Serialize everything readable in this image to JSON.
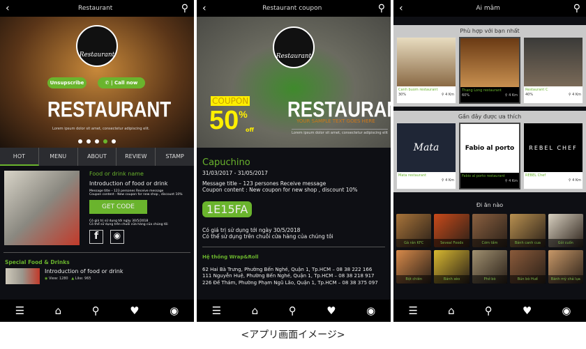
{
  "caption": "<アプリ画面イメージ>",
  "accent": "#6ab42d",
  "screen1": {
    "title": "Restaurant",
    "logo_text": "Restaurant",
    "unsubscribe": "Unsupscribe",
    "call": "Call now",
    "hero_title": "RESTAURANT",
    "hero_sub": "Lorem ipsum dolor sit amet, consectetur adipiscing elit.",
    "slides": 5,
    "active_slide": 4,
    "tabs": [
      "HOT",
      "MENU",
      "ABOUT",
      "REVIEW",
      "STAMP"
    ],
    "item": {
      "name": "Food or drink name",
      "intro": "Introduction of food or drink",
      "msg1": "Message title – 123 persones Receive message",
      "msg2": "Coupon content : New coupon for new shop , discount 10%",
      "button": "GET CODE",
      "valid1": "Có giá trị sử dụng tới ngày 30/5/2018",
      "valid2": "Có thể sử dụng trên chuỗi cửa hàng của chúng tôi"
    },
    "special": {
      "title": "Special Food & Drinks",
      "intro": "Introduction of food or drink",
      "views": "View: 1280",
      "likes": "Like: 965"
    }
  },
  "screen2": {
    "title": "Restaurant coupon",
    "logo_text": "Restaurant",
    "coupon": "COUPON",
    "percent": "50",
    "pct_sign": "%",
    "off": "off",
    "hero_title": "RESTAURANT",
    "sample": "YOUR SAMPLE TEXT GOES HERE",
    "hero_sub": "Lorem ipsum dolor sit amet, consectetur adipiscing elit",
    "name": "Capuchino",
    "dates": "31/03/2017 - 31/05/2017",
    "msg1": "Message title – 123 persones Receive message",
    "msg2": "Coupon content : New coupon for new shop , discount 10%",
    "code": "1E15FA",
    "valid1": "Có giá trị sử dụng tới ngày 30/5/2018",
    "valid2": "Có thể sử dụng trên chuỗi cửa hàng của chúng tôi",
    "chain": "Hệ thống Wrap&Roll",
    "addresses": [
      "62 Hai Bà Trưng, Phường Bến Nghé, Quận 1, Tp.HCM – 08 38 222 166",
      "111 Nguyễn Huệ, Phường Bến Nghé, Quận 1, Tp.HCM – 08 38 218 917",
      "226 Đề Thám, Phường Phạm Ngũ Lão, Quận 1, Tp.HCM – 08 38 375 097"
    ]
  },
  "screen3": {
    "title": "Ai mâm",
    "best": {
      "title": "Phù hợp với bạn nhất",
      "cards": [
        {
          "name": "Canh buom restaurant",
          "pct": "30%",
          "dist": "4 Km"
        },
        {
          "name": "Thang Long restaurant",
          "pct": "60%",
          "dist": "4 Km"
        },
        {
          "name": "Restaurant C",
          "pct": "40%",
          "dist": "4 Km"
        }
      ]
    },
    "recent": {
      "title": "Gần đây được ưa thích",
      "cards": [
        {
          "name": "Mata restaurant",
          "logo": "Mata",
          "dist": "4 Km"
        },
        {
          "name": "Fabio al porto restaurant",
          "logo": "Fabio al porto",
          "dist": "4 Km"
        },
        {
          "name": "REBEL Chef",
          "logo": "REBEL CHEF",
          "dist": "4 Km"
        }
      ]
    },
    "where": {
      "title": "Đi ăn nào",
      "tiles": [
        "Gà rán KFC",
        "Seveal Foods",
        "Cơm tấm",
        "Bánh canh cua",
        "Gỏi cuốn",
        "Bột chiên",
        "Bánh xèo",
        "Phở bò",
        "Bún bò Huế",
        "Bánh mỳ chả lụa"
      ]
    }
  },
  "nav": {
    "icons": [
      "menu-icon",
      "home-icon",
      "location-icon",
      "heart-icon",
      "camera-icon"
    ]
  }
}
